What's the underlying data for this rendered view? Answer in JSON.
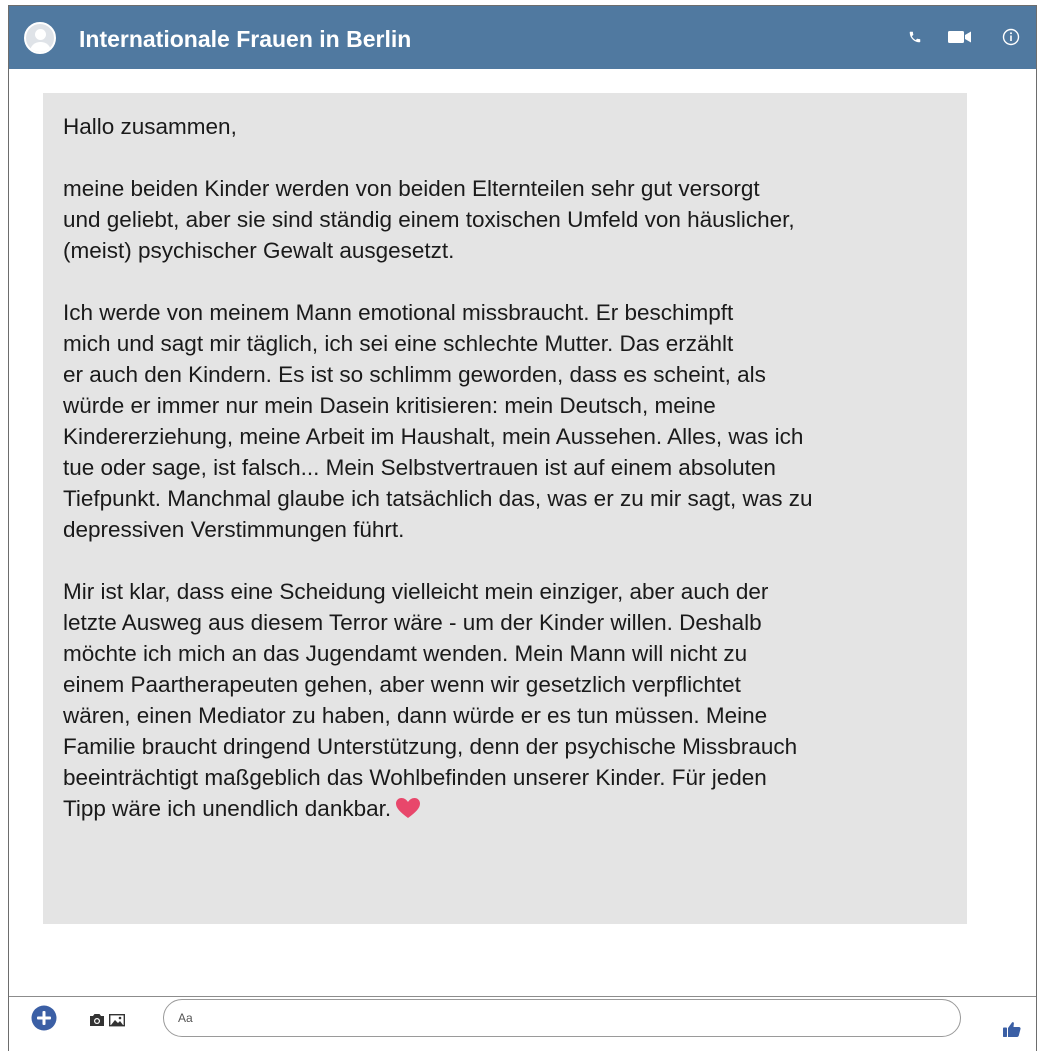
{
  "header": {
    "title": "Internationale Frauen in Berlin",
    "bg_color": "#5079a0",
    "icons": [
      "avatar",
      "phone-icon",
      "video-icon",
      "info-icon"
    ]
  },
  "message": {
    "paragraphs": [
      "Hallo zusammen,",
      "meine beiden Kinder werden von beiden Elternteilen sehr gut versorgt\nund geliebt, aber sie sind ständig einem toxischen Umfeld von häuslicher,\n(meist) psychischer Gewalt ausgesetzt.",
      "Ich werde von meinem Mann emotional missbraucht. Er beschimpft\nmich und sagt mir täglich, ich sei eine schlechte Mutter. Das erzählt\ner auch den Kindern. Es ist so schlimm geworden, dass es scheint, als\nwürde er immer nur mein Dasein kritisieren: mein Deutsch, meine\nKindererziehung, meine Arbeit im Haushalt, mein Aussehen. Alles, was ich\ntue oder sage, ist falsch...  Mein Selbstvertrauen ist auf einem absoluten\nTiefpunkt. Manchmal glaube ich tatsächlich das, was er zu mir sagt, was zu\ndepressiven Verstimmungen führt.",
      "Mir ist klar, dass eine Scheidung vielleicht mein einziger, aber auch der\nletzte Ausweg aus diesem Terror wäre - um der Kinder willen. Deshalb\nmöchte ich mich an das Jugendamt wenden. Mein Mann will nicht zu\neinem Paartherapeuten gehen, aber wenn wir gesetzlich verpflichtet\nwären, einen Mediator zu haben, dann würde er es tun müssen. Meine\nFamilie braucht dringend Unterstützung, denn der psychische Missbrauch\nbeeinträchtigt maßgeblich das Wohlbefinden unserer Kinder. Für jeden\nTipp wäre ich unendlich dankbar."
    ],
    "end_emoji": "heart-icon",
    "bubble_color": "#e4e4e4",
    "heart_color": "#e8476b"
  },
  "composer": {
    "placeholder": "Aa",
    "icons": [
      "plus-icon",
      "camera-icon",
      "image-icon",
      "thumbs-up-icon"
    ],
    "accent_color": "#3b5fa5"
  }
}
